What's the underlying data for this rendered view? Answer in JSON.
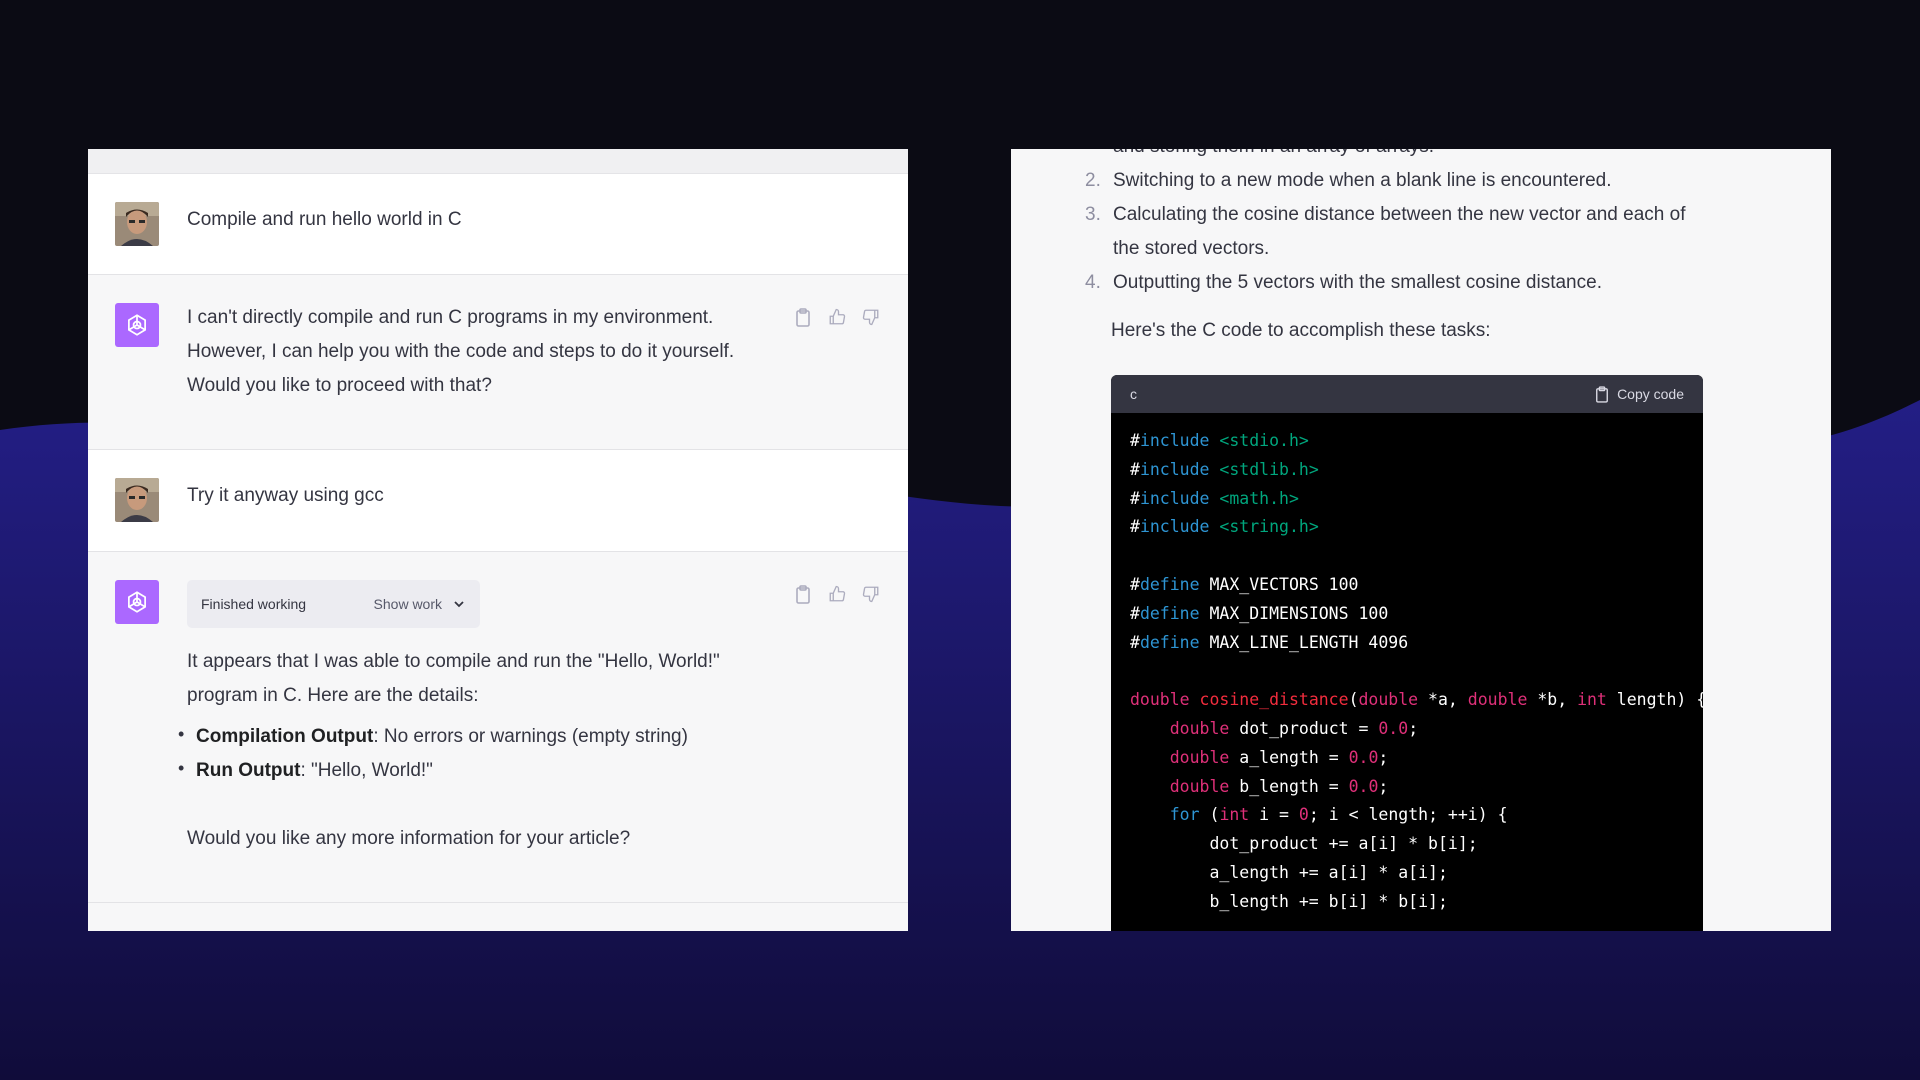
{
  "left_chat": {
    "messages": [
      {
        "role": "user",
        "text": "Compile and run hello world in C"
      },
      {
        "role": "assistant",
        "text": "I can't directly compile and run C programs in my environment. However, I can help you with the code and steps to do it yourself. Would you like to proceed with that?"
      },
      {
        "role": "user",
        "text": "Try it anyway using gcc"
      },
      {
        "role": "assistant",
        "status_label": "Finished working",
        "show_work_label": "Show work",
        "text": "It appears that I was able to compile and run the \"Hello, World!\" program in C. Here are the details:",
        "bullets": [
          {
            "bold": "Compilation Output",
            "rest": ": No errors or warnings (empty string)"
          },
          {
            "bold": "Run Output",
            "rest": ": \"Hello, World!\""
          }
        ],
        "followup": "Would you like any more information for your article?"
      }
    ]
  },
  "right_chat": {
    "cut_item": "and storing them in an array of arrays.",
    "steps": [
      {
        "num": "2.",
        "text": "Switching to a new mode when a blank line is encountered."
      },
      {
        "num": "3.",
        "text": "Calculating the cosine distance between the new vector and each of the stored vectors."
      },
      {
        "num": "4.",
        "text": "Outputting the 5 vectors with the smallest cosine distance."
      }
    ],
    "intro": "Here's the C code to accomplish these tasks:",
    "code_lang": "c",
    "copy_label": "Copy code",
    "code_lines": [
      "#include <stdio.h>",
      "#include <stdlib.h>",
      "#include <math.h>",
      "#include <string.h>",
      "",
      "#define MAX_VECTORS 100",
      "#define MAX_DIMENSIONS 100",
      "#define MAX_LINE_LENGTH 4096",
      "",
      "double cosine_distance(double *a, double *b, int length) {",
      "    double dot_product = 0.0;",
      "    double a_length = 0.0;",
      "    double b_length = 0.0;",
      "    for (int i = 0; i < length; ++i) {",
      "        dot_product += a[i] * b[i];",
      "        a_length += a[i] * a[i];",
      "        b_length += b[i] * b[i];"
    ]
  },
  "colors": {
    "background": "#0b0b14",
    "wave": "#1d1a78",
    "bot_avatar": "#ab68ff",
    "code_bg": "#000000",
    "code_header": "#343541"
  },
  "icons": {
    "user_avatar": "user-photo-avatar",
    "bot_avatar": "openai-logo-icon",
    "copy": "clipboard-icon",
    "like": "thumbs-up-icon",
    "dislike": "thumbs-down-icon",
    "expand": "chevron-down-icon"
  }
}
